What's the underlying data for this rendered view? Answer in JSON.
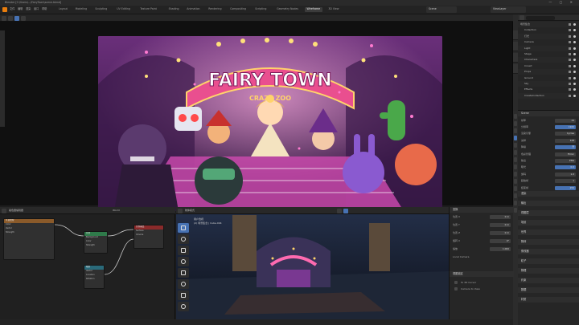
{
  "titlebar": {
    "text": "Blender [C:\\Users\\...\\FairyTown\\scene.blend]",
    "window_controls": "— ▢ ✕"
  },
  "menu": [
    "文件",
    "编辑",
    "渲染",
    "窗口",
    "帮助"
  ],
  "workspaces": [
    {
      "label": "Layout",
      "active": false
    },
    {
      "label": "Modeling",
      "active": false
    },
    {
      "label": "Sculpting",
      "active": false
    },
    {
      "label": "UV Editing",
      "active": false
    },
    {
      "label": "Texture Paint",
      "active": false
    },
    {
      "label": "Shading",
      "active": false
    },
    {
      "label": "Animation",
      "active": false
    },
    {
      "label": "Rendering",
      "active": false
    },
    {
      "label": "Compositing",
      "active": false
    },
    {
      "label": "Scripting",
      "active": false
    },
    {
      "label": "Geometry Nodes",
      "active": false
    },
    {
      "label": "Wireframe",
      "active": true
    },
    {
      "label": "3D View",
      "active": false
    }
  ],
  "topbar": {
    "scene_label": "Scene",
    "view_layer_label": "ViewLayer"
  },
  "render_image": {
    "banner_text": "FAIRY TOWN",
    "sub_text": "CRAZY ZOO",
    "colors": {
      "bg_top": "#6a2f7a",
      "bg_bottom": "#2a1436",
      "banner": "#e94f8f",
      "banner_stroke": "#ffd36b",
      "stage": "#d04bb0"
    }
  },
  "outliner": {
    "rows": [
      "场景集合",
      "Collection",
      "灯光",
      "Camera",
      "Light",
      "Stage",
      "Characters",
      "Crowd",
      "Props",
      "Ground",
      "Sky",
      "Effects",
      "CreateCollection"
    ]
  },
  "props": {
    "header": "Scene",
    "rows": [
      {
        "label": "帧率",
        "value": "24"
      },
      {
        "label": "分辨率",
        "value": "1920"
      },
      {
        "label": "渲染引擎",
        "value": "Cycles"
      },
      {
        "label": "采样",
        "value": "128"
      },
      {
        "label": "降噪",
        "value": "开"
      },
      {
        "label": "色彩管理",
        "value": "Filmic"
      },
      {
        "label": "输出",
        "value": "PNG"
      },
      {
        "label": "曝光",
        "value": "0.0"
      },
      {
        "label": "伽玛",
        "value": "1.0"
      },
      {
        "label": "起始帧",
        "value": "1"
      },
      {
        "label": "结束帧",
        "value": "250"
      }
    ],
    "sections": [
      "渲染",
      "输出",
      "视图层",
      "场景",
      "世界",
      "物体",
      "修改器",
      "粒子",
      "物理",
      "约束",
      "数据",
      "材质"
    ]
  },
  "node_editor": {
    "header_label": "着色器编辑器",
    "material_label": "World",
    "nodes": [
      {
        "title": "环境纹理",
        "head_color": "#8a5a2a",
        "rows": [
          "Color",
          "Vector",
          "Strength"
        ]
      },
      {
        "title": "背景",
        "head_color": "#2f7a4a",
        "rows": [
          "Background",
          "Color",
          "Strength"
        ]
      },
      {
        "title": "世界输出",
        "head_color": "#8a2a2a",
        "rows": [
          "Surface",
          "Volume"
        ]
      },
      {
        "title": "映射",
        "head_color": "#2a6a7a",
        "rows": [
          "Vector",
          "Location",
          "Rotation"
        ]
      }
    ]
  },
  "view3d": {
    "header_label": "物体模式",
    "info_line1": "用户透视",
    "info_line2": "(2) 场景集合 | Cube.004",
    "tools": [
      "select-icon",
      "cursor-icon",
      "move-icon",
      "rotate-icon",
      "scale-icon",
      "transform-icon",
      "annotate-icon",
      "measure-icon"
    ]
  },
  "npanel": {
    "section": "变换",
    "rows": [
      {
        "label": "位置 X",
        "value": "0 m"
      },
      {
        "label": "位置 Y",
        "value": "0 m"
      },
      {
        "label": "位置 Z",
        "value": "0 m"
      },
      {
        "label": "旋转 X",
        "value": "0°"
      },
      {
        "label": "缩放",
        "value": "1.000"
      },
      {
        "label": "Local Camera",
        "value": ""
      }
    ],
    "checks": [
      "To 3D Cursor",
      "Camera to View"
    ],
    "section2": "视图锁定"
  }
}
